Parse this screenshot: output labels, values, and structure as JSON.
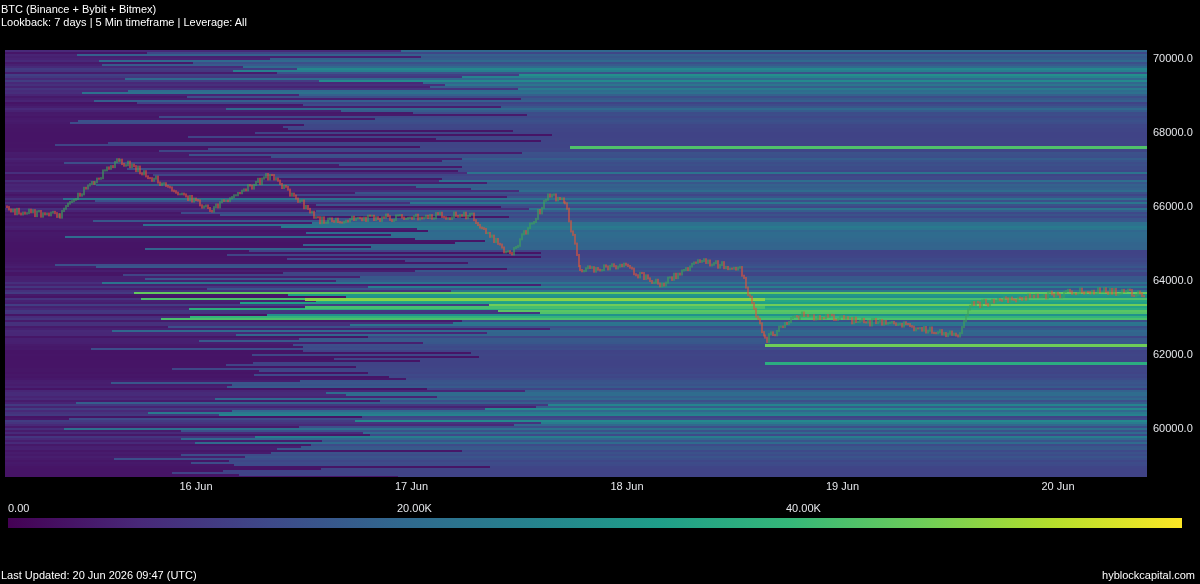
{
  "header": {
    "title": "BTC (Binance + Bybit + Bitmex)",
    "subtitle": "Lookback: 7 days | 5 Min timeframe | Leverage: All"
  },
  "heatmap": {
    "price_ticks": [
      "70000.0",
      "68000.0",
      "66000.0",
      "64000.0",
      "62000.0",
      "60000.0"
    ],
    "date_ticks": [
      "16 Jun",
      "17 Jun",
      "18 Jun",
      "19 Jun",
      "20 Jun"
    ]
  },
  "colorbar": {
    "ticks": [
      "0.00",
      "20.00K",
      "40.00K"
    ]
  },
  "footer": {
    "last_updated": "Last Updated: 20 Jun 2026 09:47 (UTC)",
    "site": "hyblockcapital.com"
  }
}
